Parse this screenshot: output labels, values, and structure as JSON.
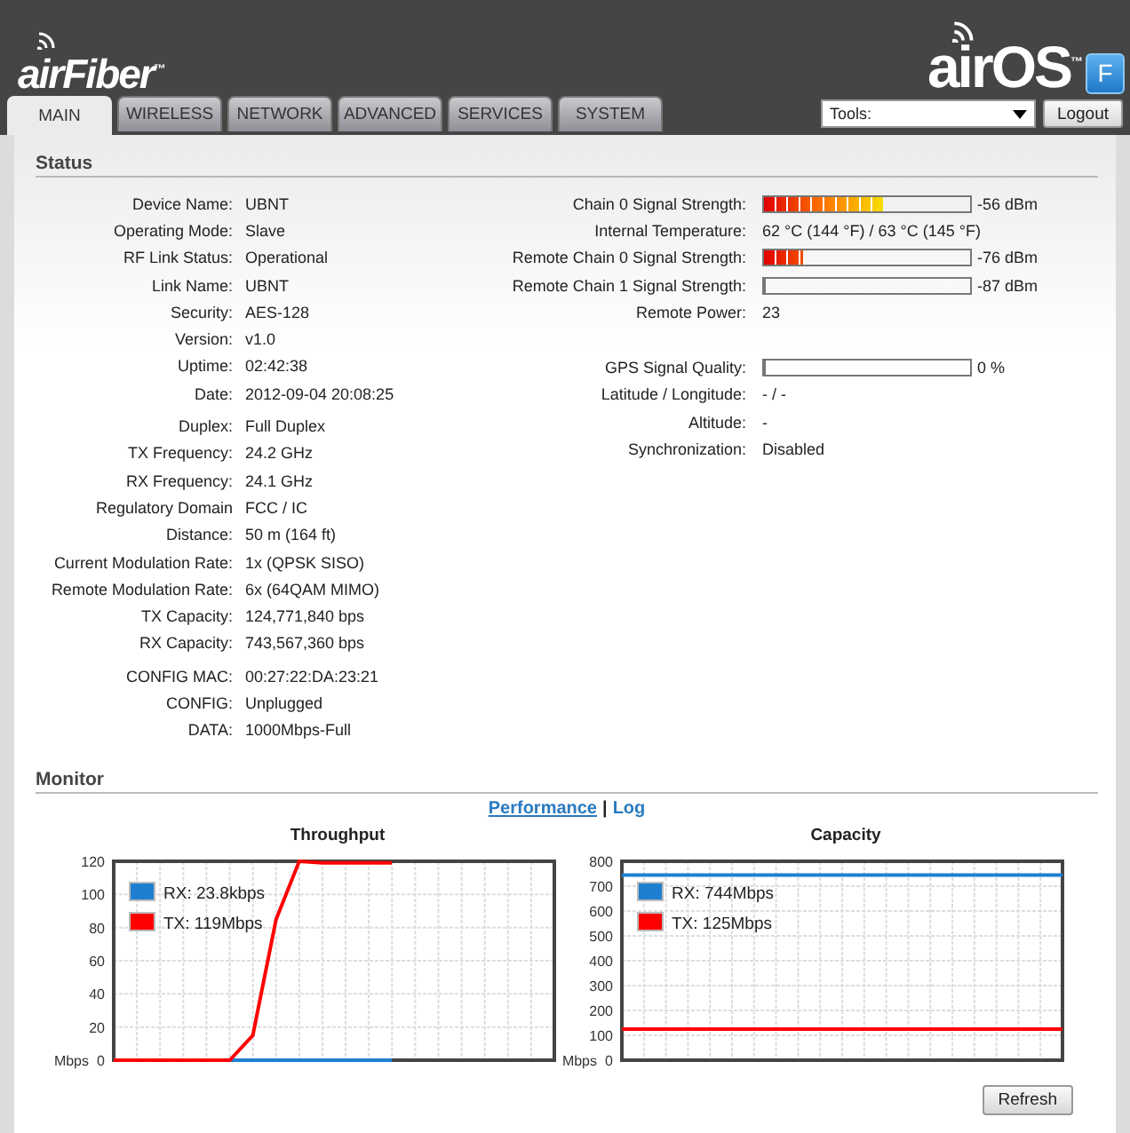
{
  "header": {
    "brand": "airFiber$^{™}$",
    "product": "airOS$^{™}$",
    "badge": "F"
  },
  "tabs": [
    {
      "label": "MAIN",
      "selected": true
    },
    {
      "label": "WIRELESS",
      "selected": false
    },
    {
      "label": "NETWORK",
      "selected": false
    },
    {
      "label": "ADVANCED",
      "selected": false
    },
    {
      "label": "SERVICES",
      "selected": false
    },
    {
      "label": "SYSTEM",
      "selected": false
    }
  ],
  "tools": {
    "value": "Tools:"
  },
  "logout": "Logout",
  "status": {
    "title": "Status",
    "left_groups": [
      [
        {
          "label": "Device Name:",
          "value": "UBNT"
        },
        {
          "label": "Operating Mode:",
          "value": "Slave"
        },
        {
          "label": "RF Link Status:",
          "value": "Operational"
        },
        {
          "label": "Link Name:",
          "value": "UBNT"
        },
        {
          "label": "Security:",
          "value": "AES-128"
        },
        {
          "label": "Version:",
          "value": "v1.0"
        },
        {
          "label": "Uptime:",
          "value": "02:42:38"
        },
        {
          "label": "Date:",
          "value": "2012-09-04 20:08:25"
        }
      ],
      [
        {
          "label": "Duplex:",
          "value": "Full Duplex"
        },
        {
          "label": "TX Frequency:",
          "value": "24.2 GHz"
        },
        {
          "label": "RX Frequency:",
          "value": "24.1 GHz"
        },
        {
          "label": "Regulatory Domain",
          "value": "FCC / IC"
        },
        {
          "label": "Distance:",
          "value": "50 m (164 ft)"
        },
        {
          "label": "Current Modulation Rate:",
          "value": "1x (QPSK SISO)"
        },
        {
          "label": "Remote Modulation Rate:",
          "value": "6x (64QAM MIMO)"
        },
        {
          "label": "TX Capacity:",
          "value": "124,771,840 bps"
        },
        {
          "label": "RX Capacity:",
          "value": "743,567,360 bps"
        }
      ],
      [
        {
          "label": "CONFIG MAC:",
          "value": "00:27:22:DA:23:21"
        },
        {
          "label": "CONFIG:",
          "value": "Unplugged"
        },
        {
          "label": "DATA:",
          "value": "1000Mbps-Full"
        }
      ]
    ],
    "right_groups": [
      [
        {
          "kind": "meter",
          "label": "Chain 0 Signal Strength:",
          "level": 0.58,
          "value": "-56 dBm"
        },
        {
          "kind": "text",
          "label": "Internal Temperature:",
          "value": "62 °C (144 °F) / 63 °C (145 °F)"
        },
        {
          "kind": "meter",
          "label": "Remote Chain 0 Signal Strength:",
          "level": 0.19,
          "value": "-76 dBm"
        },
        {
          "kind": "meter",
          "label": "Remote Chain 1 Signal Strength:",
          "level": 0,
          "value": "-87 dBm"
        },
        {
          "kind": "text",
          "label": "Remote Power:",
          "value": "23"
        }
      ],
      [
        {
          "kind": "plain",
          "label": "GPS Signal Quality:",
          "level": 0,
          "value": "0 %"
        },
        {
          "kind": "text",
          "label": "Latitude / Longitude:",
          "value": "- / -"
        },
        {
          "kind": "text",
          "label": "Altitude:",
          "value": "-"
        },
        {
          "kind": "text",
          "label": "Synchronization:",
          "value": "Disabled"
        }
      ]
    ]
  },
  "monitor": {
    "title": "Monitor",
    "links": [
      {
        "label": "Performance",
        "selected": true
      },
      {
        "label": "Log",
        "selected": false
      }
    ],
    "separator": "|",
    "charts": [
      {
        "chart_data": {
          "type": "line",
          "grid": true,
          "legend": true,
          "title": "Throughput",
          "ylabel": "Mbps",
          "categories": [
            null,
            null,
            null,
            null,
            null,
            null,
            null,
            null,
            null,
            null,
            null,
            null,
            null,
            null,
            null,
            null,
            null,
            null,
            null,
            null
          ],
          "ylim": [
            0,
            120
          ],
          "yticks": [
            0,
            20,
            40,
            60,
            80,
            100,
            120
          ],
          "series": [
            {
              "name": "RX: 23.8kbps",
              "color": "#1e7fd0",
              "values": [
                null,
                null,
                null,
                null,
                null,
                0,
                0,
                0,
                0,
                0,
                0,
                0,
                0,
                null,
                null,
                null,
                null,
                null,
                null,
                null
              ]
            },
            {
              "name": "TX: 119Mbps",
              "color": "#ff0000",
              "values": [
                0,
                0,
                0,
                0,
                0,
                0,
                15,
                85,
                120,
                119,
                119,
                119,
                119,
                null,
                null,
                null,
                null,
                null,
                null,
                null
              ]
            }
          ]
        }
      },
      {
        "chart_data": {
          "type": "line",
          "grid": true,
          "legend": true,
          "title": "Capacity",
          "ylabel": "Mbps",
          "categories": [
            null,
            null,
            null,
            null,
            null,
            null,
            null,
            null,
            null,
            null,
            null,
            null,
            null,
            null,
            null,
            null,
            null,
            null,
            null,
            null,
            null
          ],
          "ylim": [
            0,
            800
          ],
          "yticks": [
            0,
            100,
            200,
            300,
            400,
            500,
            600,
            700,
            800
          ],
          "series": [
            {
              "name": "RX: 744Mbps",
              "color": "#1e7fd0",
              "values": [
                744,
                744,
                744,
                744,
                744,
                744,
                744,
                744,
                744,
                744,
                744,
                744,
                744,
                744,
                744,
                744,
                744,
                744,
                744,
                744,
                744
              ]
            },
            {
              "name": "TX: 125Mbps",
              "color": "#ff0000",
              "values": [
                125,
                125,
                125,
                125,
                125,
                125,
                125,
                125,
                125,
                125,
                125,
                125,
                125,
                125,
                125,
                125,
                125,
                125,
                125,
                125,
                125
              ]
            }
          ]
        }
      }
    ],
    "refresh": "Refresh"
  }
}
